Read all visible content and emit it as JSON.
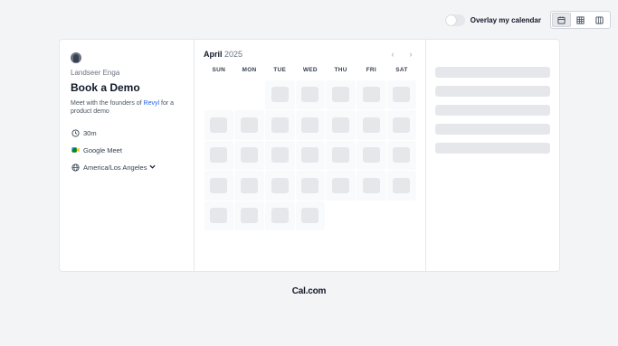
{
  "topbar": {
    "overlay_label": "Overlay my calendar",
    "views": [
      "calendar-month-view",
      "grid-week-view",
      "columns-view"
    ]
  },
  "event": {
    "host_name": "Landseer Enga",
    "title": "Book a Demo",
    "description_prefix": "Meet with the founders of ",
    "description_link": "Revyl",
    "description_suffix": " for a product demo",
    "duration": "30m",
    "location": "Google Meet",
    "timezone": "America/Los Angeles"
  },
  "calendar": {
    "month": "April",
    "year": "2025",
    "weekdays": [
      "SUN",
      "MON",
      "TUE",
      "WED",
      "THU",
      "FRI",
      "SAT"
    ],
    "leading_blanks": 2,
    "days_in_month": 30
  },
  "footer": {
    "brand": "Cal.com"
  },
  "colors": {
    "accent_link": "#2563eb",
    "background": "#f3f4f6",
    "skeleton": "#e5e7eb"
  }
}
